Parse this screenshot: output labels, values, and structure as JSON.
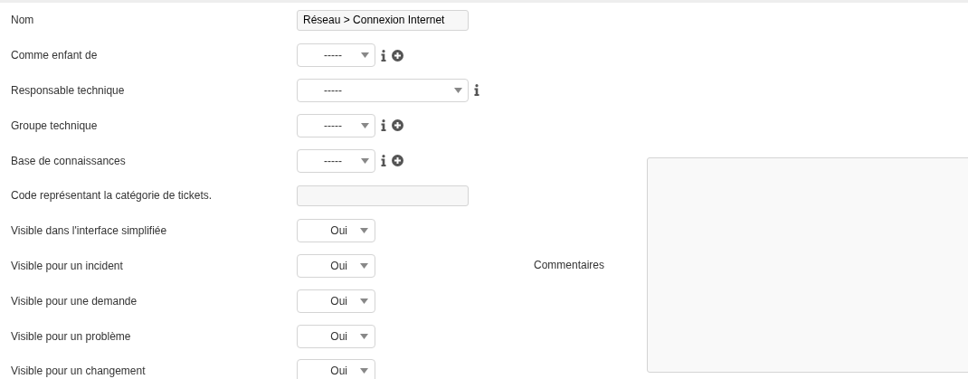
{
  "fields": [
    {
      "label": "Nom",
      "kind": "text",
      "value": "Réseau > Connexion Internet"
    },
    {
      "label": "Comme enfant de",
      "kind": "select",
      "value": "-----"
    },
    {
      "label": "Responsable technique",
      "kind": "select_wide",
      "value": "-----"
    },
    {
      "label": "Groupe technique",
      "kind": "select",
      "value": "-----"
    },
    {
      "label": "Base de connaissances",
      "kind": "select",
      "value": "-----"
    },
    {
      "label": "Code représentant la catégorie de tickets.",
      "kind": "text"
    },
    {
      "label": "Visible dans l'interface simplifiée",
      "kind": "yesno",
      "value": "Oui"
    },
    {
      "label": "Visible pour un incident",
      "kind": "yesno",
      "value": "Oui"
    },
    {
      "label": "Visible pour une demande",
      "kind": "yesno",
      "value": "Oui"
    },
    {
      "label": "Visible pour un problème",
      "kind": "yesno",
      "value": "Oui"
    },
    {
      "label": "Visible pour un changement",
      "kind": "yesno",
      "value": "Oui"
    }
  ],
  "comments": {
    "label": "Commentaires"
  }
}
